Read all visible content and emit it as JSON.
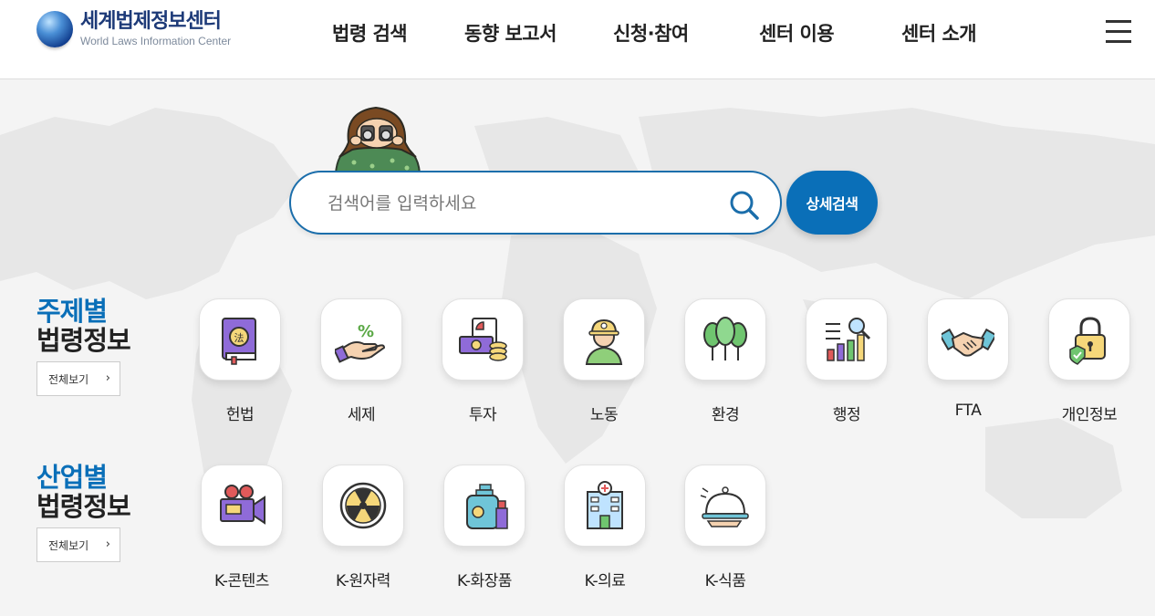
{
  "header": {
    "logo_ko": "세계법제정보센터",
    "logo_en": "World Laws Information Center",
    "nav": [
      {
        "label": "법령 검색"
      },
      {
        "label": "동향 보고서"
      },
      {
        "label": "신청·참여"
      },
      {
        "label": "센터 이용"
      },
      {
        "label": "센터 소개"
      }
    ]
  },
  "search": {
    "placeholder": "검색어를 입력하세요",
    "value": "",
    "detail_label": "상세검색"
  },
  "topic_section": {
    "title_line1": "주제별",
    "title_line2": "법령정보",
    "view_all": "전체보기",
    "items": [
      {
        "label": "헌법",
        "icon": "constitution-book-icon"
      },
      {
        "label": "세제",
        "icon": "tax-hand-icon"
      },
      {
        "label": "투자",
        "icon": "investment-money-icon"
      },
      {
        "label": "노동",
        "icon": "worker-icon"
      },
      {
        "label": "환경",
        "icon": "trees-icon"
      },
      {
        "label": "행정",
        "icon": "admin-chart-icon"
      },
      {
        "label": "FTA",
        "icon": "handshake-icon"
      },
      {
        "label": "개인정보",
        "icon": "privacy-lock-icon"
      }
    ]
  },
  "industry_section": {
    "title_line1": "산업별",
    "title_line2": "법령정보",
    "view_all": "전체보기",
    "items": [
      {
        "label": "K-콘텐츠",
        "icon": "video-camera-icon"
      },
      {
        "label": "K-원자력",
        "icon": "radiation-icon"
      },
      {
        "label": "K-화장품",
        "icon": "cosmetics-icon"
      },
      {
        "label": "K-의료",
        "icon": "hospital-icon"
      },
      {
        "label": "K-식품",
        "icon": "food-cloche-icon"
      }
    ]
  },
  "colors": {
    "primary": "#0a6fb8",
    "logo": "#1d3a78",
    "background": "#f4f4f4"
  }
}
